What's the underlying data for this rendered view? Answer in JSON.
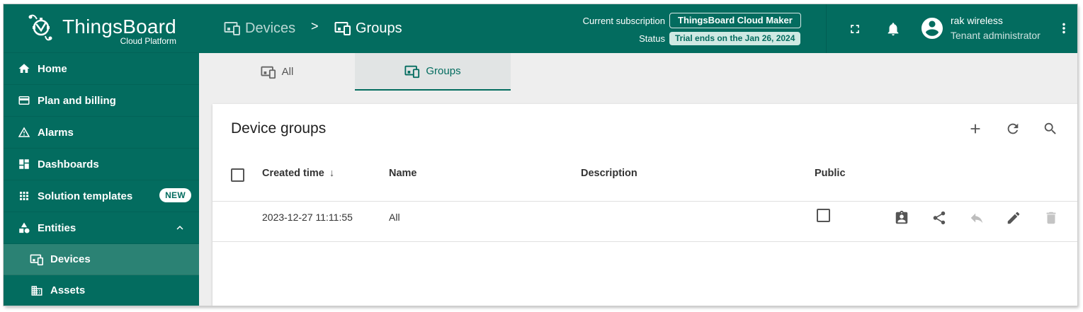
{
  "brand": {
    "title": "ThingsBoard",
    "subtitle": "Cloud Platform"
  },
  "sidebar": {
    "items": [
      {
        "label": "Home",
        "icon": "home-icon"
      },
      {
        "label": "Plan and billing",
        "icon": "credit-card-icon"
      },
      {
        "label": "Alarms",
        "icon": "warning-icon"
      },
      {
        "label": "Dashboards",
        "icon": "dashboard-icon"
      },
      {
        "label": "Solution templates",
        "icon": "apps-icon",
        "badge": "NEW"
      },
      {
        "label": "Entities",
        "icon": "category-icon",
        "expanded": true
      },
      {
        "label": "Devices",
        "icon": "devices-icon",
        "active": true
      },
      {
        "label": "Assets",
        "icon": "domain-icon"
      }
    ]
  },
  "header": {
    "breadcrumb": [
      {
        "label": "Devices",
        "icon": "devices-icon"
      },
      {
        "label": "Groups",
        "icon": "devices-icon"
      }
    ],
    "separator": ">",
    "subscription_label": "Current subscription",
    "subscription_value": "ThingsBoard Cloud Maker",
    "status_label": "Status",
    "status_value": "Trial ends on the Jan 26, 2024",
    "user_name": "rak wireless",
    "user_role": "Tenant administrator"
  },
  "tabs": [
    {
      "label": "All",
      "active": false
    },
    {
      "label": "Groups",
      "active": true
    }
  ],
  "card": {
    "title": "Device groups",
    "columns": [
      "Created time",
      "Name",
      "Description",
      "Public"
    ],
    "sort_indicator": "↓",
    "rows": [
      {
        "created": "2023-12-27 11:11:55",
        "name": "All",
        "description": "",
        "public": false
      }
    ]
  },
  "colors": {
    "primary": "#036c5f",
    "active_nav": "#2b8274",
    "trial_chip": "#cfe9e3",
    "background": "#eeeeee"
  }
}
